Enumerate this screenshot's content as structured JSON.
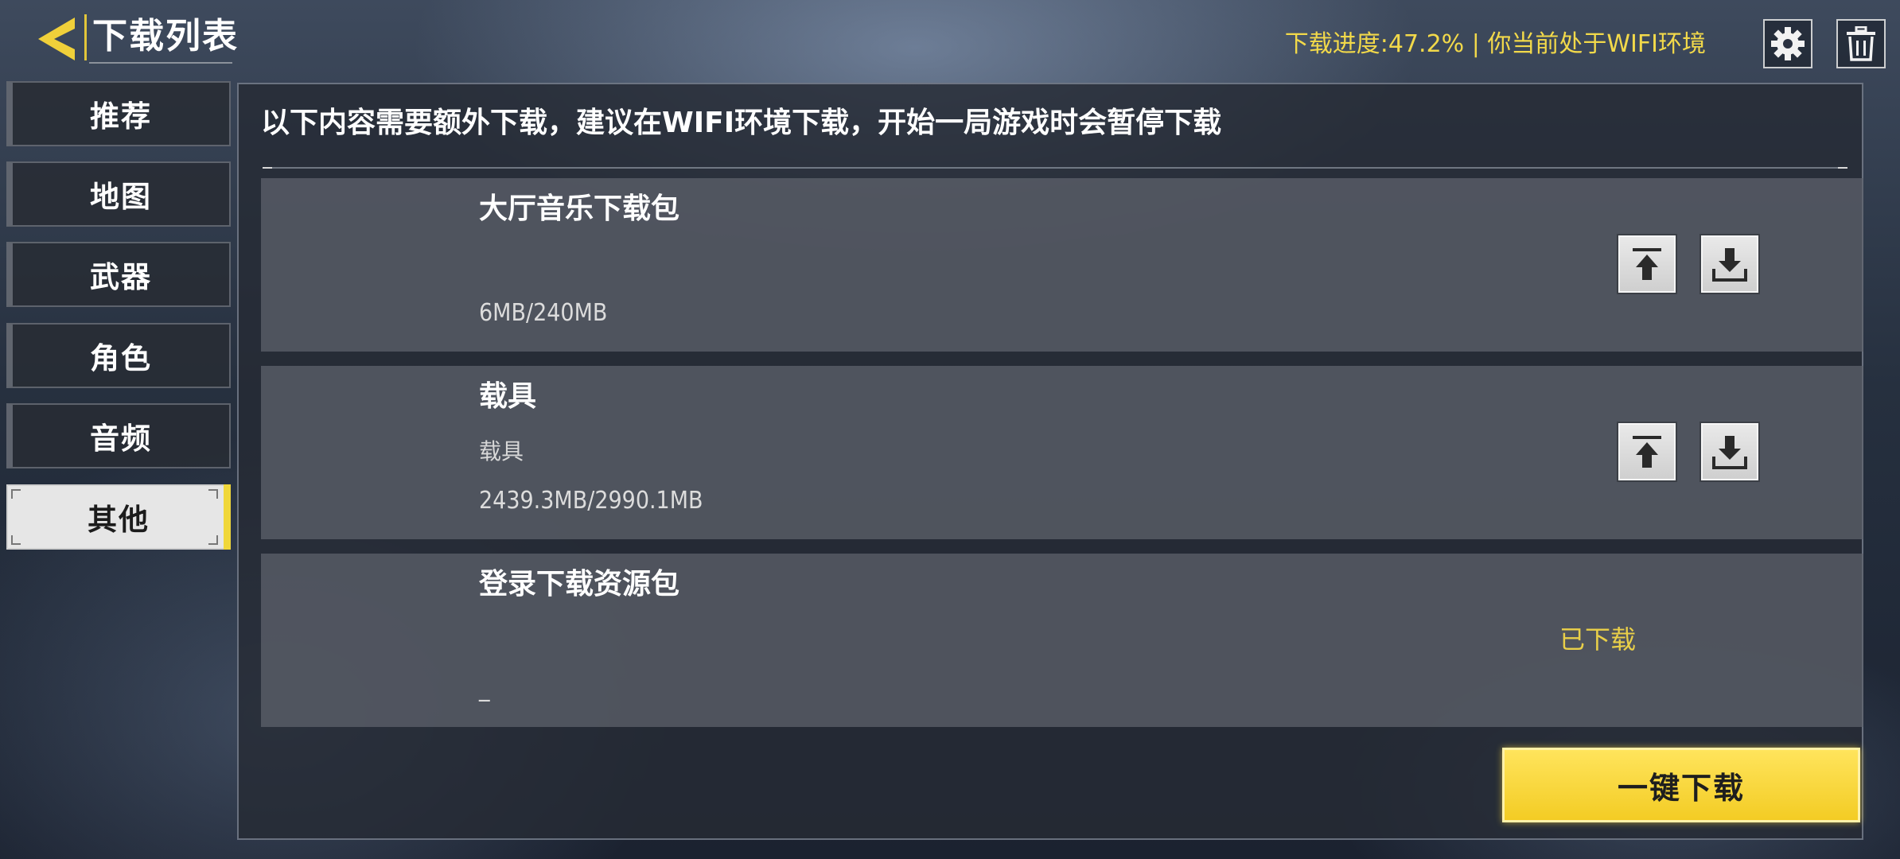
{
  "header": {
    "title": "下载列表",
    "status": "下载进度:47.2% | 你当前处于WIFI环境"
  },
  "sidebar": {
    "items": [
      {
        "label": "推荐",
        "active": false
      },
      {
        "label": "地图",
        "active": false
      },
      {
        "label": "武器",
        "active": false
      },
      {
        "label": "角色",
        "active": false
      },
      {
        "label": "音频",
        "active": false
      },
      {
        "label": "其他",
        "active": true
      }
    ]
  },
  "main": {
    "notice": "以下内容需要额外下载，建议在WIFI环境下载，开始一局游戏时会暂停下载",
    "packages": [
      {
        "name": "大厅音乐下载包",
        "desc": "",
        "size": "6MB/240MB",
        "status": ""
      },
      {
        "name": "载具",
        "desc": "载具",
        "size": "2439.3MB/2990.1MB",
        "status": ""
      },
      {
        "name": "登录下载资源包",
        "desc": "",
        "size": "_",
        "status": "已下载"
      }
    ],
    "one_key_download": "一键下载"
  },
  "colors": {
    "accent": "#f2d94a",
    "button_yellow": "#f3cc24"
  },
  "icons": [
    "back-arrow-icon",
    "gear-icon",
    "trash-icon",
    "upload-icon",
    "download-icon"
  ]
}
